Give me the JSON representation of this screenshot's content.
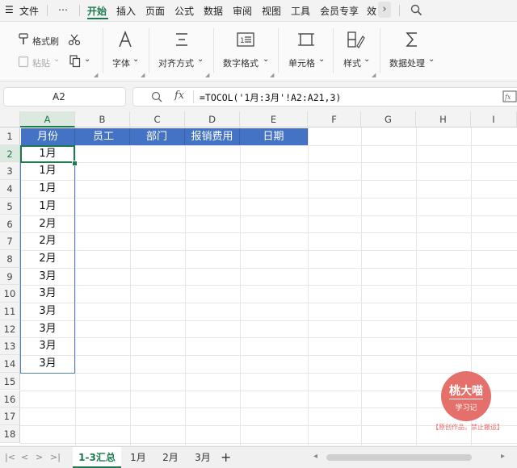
{
  "menubar": {
    "hamburger": "☰",
    "file": "文件",
    "more": "⋯",
    "tabs": [
      "开始",
      "插入",
      "页面",
      "公式",
      "数据",
      "审阅",
      "视图",
      "工具",
      "会员专享",
      "效"
    ],
    "active_tab": "开始",
    "overflow": "›",
    "search_icon": "search-icon",
    "accent": "#1c7a4e"
  },
  "ribbon": {
    "format_painter": "格式刷",
    "paste": "粘贴",
    "font": "字体",
    "align": "对齐方式",
    "number_format": "数字格式",
    "cell": "单元格",
    "style": "样式",
    "data_process": "数据处理",
    "dropdown": "⌄"
  },
  "formula_bar": {
    "name_box": "A2",
    "fx": "fx",
    "formula": "=TOCOL('1月:3月'!A2:A21,3)"
  },
  "sheet": {
    "columns": [
      "A",
      "B",
      "C",
      "D",
      "E",
      "F",
      "G",
      "H",
      "I"
    ],
    "rows": [
      "1",
      "2",
      "3",
      "4",
      "5",
      "6",
      "7",
      "8",
      "9",
      "10",
      "11",
      "12",
      "13",
      "14",
      "15",
      "16",
      "17",
      "18"
    ],
    "selected_column": "A",
    "header_row": [
      "月份",
      "员工",
      "部门",
      "报销费用",
      "日期"
    ],
    "header_fill": "#4472c4",
    "column_a_values": [
      "1月",
      "1月",
      "1月",
      "1月",
      "2月",
      "2月",
      "2月",
      "3月",
      "3月",
      "3月",
      "3月",
      "3月",
      "3月"
    ]
  },
  "watermark": {
    "name": "桃大喵",
    "sub": "学习记",
    "note": "【原创作品，禁止搬运】",
    "color": "#e46f6b"
  },
  "tabbar": {
    "nav": [
      "|<",
      "<",
      ">",
      ">|"
    ],
    "sheets": [
      "1-3汇总",
      "1月",
      "2月",
      "3月"
    ],
    "active_sheet": "1-3汇总",
    "add": "+"
  }
}
